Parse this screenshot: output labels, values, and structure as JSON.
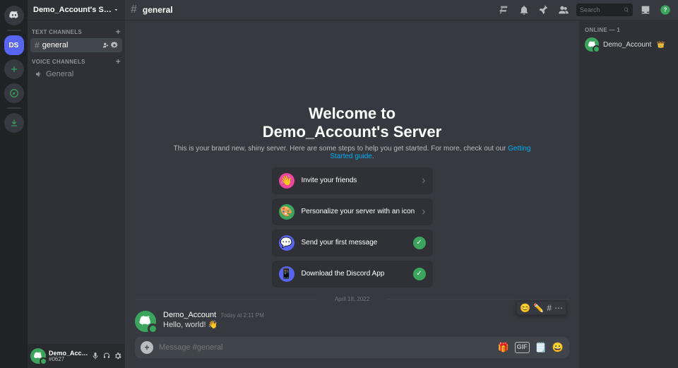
{
  "rail": {
    "server_initials": "DS"
  },
  "sidebar": {
    "server_name": "Demo_Account's Server",
    "text_category": "TEXT CHANNELS",
    "voice_category": "VOICE CHANNELS",
    "text_channels": [
      {
        "name": "general"
      }
    ],
    "voice_channels": [
      {
        "name": "General"
      }
    ]
  },
  "user_panel": {
    "name": "Demo_Acco...",
    "tag": "#0627"
  },
  "topbar": {
    "channel": "general",
    "search_placeholder": "Search"
  },
  "welcome": {
    "title_line1": "Welcome to",
    "title_line2": "Demo_Account's Server",
    "subtitle": "This is your brand new, shiny server. Here are some steps to help you get started. For more, check out our ",
    "guide_link": "Getting Started guide",
    "cards": [
      {
        "label": "Invite your friends",
        "done": false
      },
      {
        "label": "Personalize your server with an icon",
        "done": false
      },
      {
        "label": "Send your first message",
        "done": true
      },
      {
        "label": "Download the Discord App",
        "done": true
      }
    ]
  },
  "divider_date": "April 18, 2022",
  "message": {
    "author": "Demo_Account",
    "timestamp": "Today at 2:11 PM",
    "text": "Hello, world! 👋"
  },
  "composer": {
    "placeholder": "Message #general"
  },
  "members": {
    "section": "ONLINE — 1",
    "items": [
      {
        "name": "Demo_Account",
        "owner": true
      }
    ]
  }
}
